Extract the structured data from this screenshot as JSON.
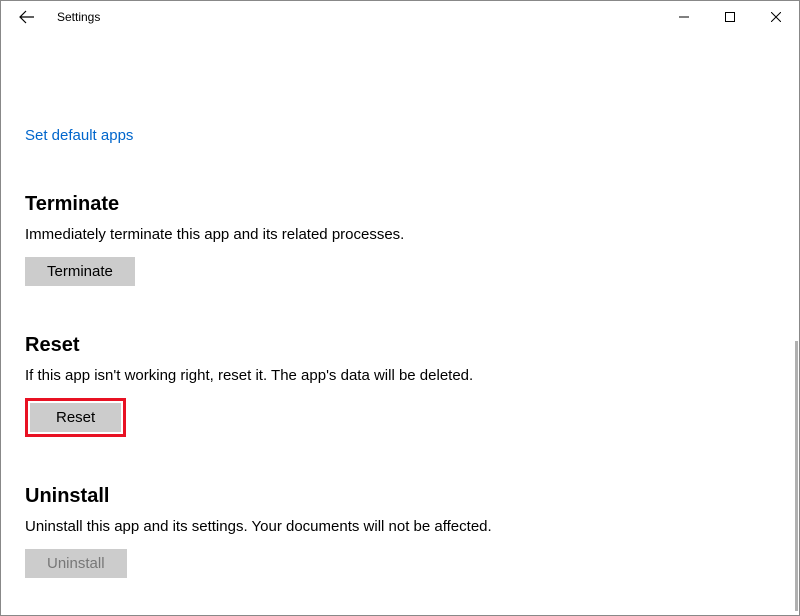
{
  "window": {
    "title": "Settings"
  },
  "link": {
    "set_default_apps": "Set default apps"
  },
  "sections": {
    "terminate": {
      "title": "Terminate",
      "desc": "Immediately terminate this app and its related processes.",
      "button": "Terminate"
    },
    "reset": {
      "title": "Reset",
      "desc": "If this app isn't working right, reset it. The app's data will be deleted.",
      "button": "Reset"
    },
    "uninstall": {
      "title": "Uninstall",
      "desc": "Uninstall this app and its settings. Your documents will not be affected.",
      "button": "Uninstall"
    }
  }
}
